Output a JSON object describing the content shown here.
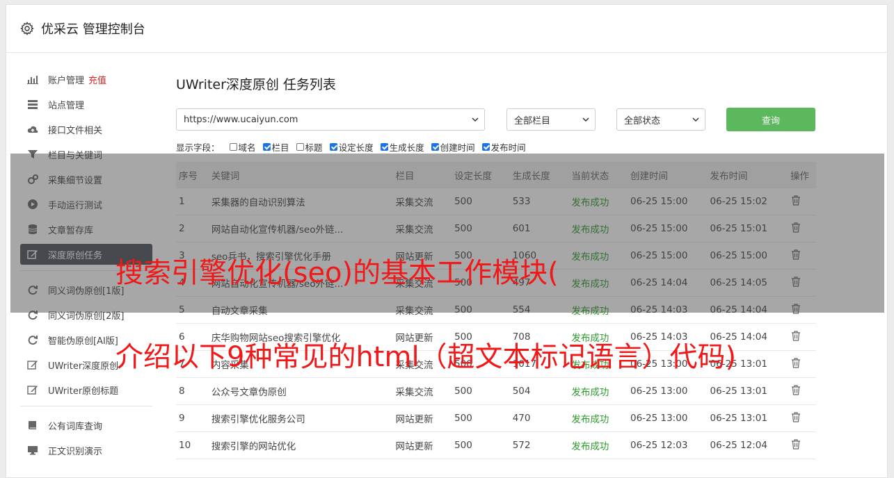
{
  "header": {
    "title": "优采云 管理控制台"
  },
  "sidebar": {
    "items": [
      {
        "label": "账户管理",
        "extra": "充值",
        "icon": "bar-chart-icon"
      },
      {
        "label": "站点管理",
        "icon": "server-icon"
      },
      {
        "label": "接口文件相关",
        "icon": "cloud-upload-icon"
      },
      {
        "label": "栏目与关键词",
        "icon": "filter-icon"
      },
      {
        "label": "采集细节设置",
        "icon": "gears-icon"
      },
      {
        "label": "手动运行测试",
        "icon": "play-circle-icon"
      },
      {
        "label": "文章暂存库",
        "icon": "database-icon"
      },
      {
        "label": "深度原创任务",
        "icon": "edit-icon",
        "active": true
      },
      {
        "label": "同义词伪原创[1版]",
        "icon": "refresh-icon"
      },
      {
        "label": "同义词伪原创[2版]",
        "icon": "refresh-icon"
      },
      {
        "label": "智能伪原创[AI版]",
        "icon": "refresh-icon"
      },
      {
        "label": "UWriter深度原创",
        "icon": "edit-icon"
      },
      {
        "label": "UWriter原创标题",
        "icon": "edit-icon"
      },
      {
        "label": "公有词库查询",
        "icon": "book-icon"
      },
      {
        "label": "正文识别演示",
        "icon": "monitor-icon"
      }
    ]
  },
  "main": {
    "title": "UWriter深度原创 任务列表",
    "site_select": "https://www.ucaiyun.com",
    "column_select": "全部栏目",
    "status_select": "全部状态",
    "query_button": "查询",
    "fields_label": "显示字段：",
    "fields": [
      {
        "label": "域名",
        "checked": false
      },
      {
        "label": "栏目",
        "checked": true
      },
      {
        "label": "标题",
        "checked": false
      },
      {
        "label": "设定长度",
        "checked": true
      },
      {
        "label": "生成长度",
        "checked": true
      },
      {
        "label": "创建时间",
        "checked": true
      },
      {
        "label": "发布时间",
        "checked": true
      }
    ],
    "table": {
      "headers": [
        "序号",
        "关键词",
        "栏目",
        "设定长度",
        "生成长度",
        "当前状态",
        "创建时间",
        "发布时间",
        "操作"
      ],
      "rows": [
        [
          "1",
          "采集器的自动识别算法",
          "采集交流",
          "500",
          "533",
          "发布成功",
          "06-25 15:00",
          "06-25 15:02"
        ],
        [
          "2",
          "网站自动化宣传机器/seo外链...",
          "采集交流",
          "500",
          "601",
          "发布成功",
          "06-25 15:00",
          "06-25 15:01"
        ],
        [
          "3",
          "seo兵书，搜索引擎优化手册",
          "网站更新",
          "500",
          "1060",
          "发布成功",
          "06-25 15:00",
          "06-25 15:00"
        ],
        [
          "4",
          "网站自动化宣传机器/seo外链...",
          "采集交流",
          "500",
          "497",
          "发布成功",
          "06-25 14:04",
          "06-25 14:05"
        ],
        [
          "5",
          "自动文章采集",
          "采集交流",
          "500",
          "554",
          "发布成功",
          "06-25 14:03",
          "06-25 14:04"
        ],
        [
          "6",
          "庆华购物网站seo搜索引擎优化",
          "网站更新",
          "500",
          "708",
          "发布成功",
          "06-25 14:03",
          "06-25 14:04"
        ],
        [
          "7",
          "内容采集",
          "采集交流",
          "500",
          "1017",
          "发布成功",
          "06-25 13:00",
          "06-25 13:01"
        ],
        [
          "8",
          "公众号文章伪原创",
          "采集交流",
          "500",
          "504",
          "发布成功",
          "06-25 13:00",
          "06-25 13:01"
        ],
        [
          "9",
          "搜索引擎优化服务公司",
          "网站更新",
          "500",
          "470",
          "发布成功",
          "06-25 13:00",
          "06-25 13:01"
        ],
        [
          "10",
          "搜索引擎的网站优化",
          "网站更新",
          "500",
          "572",
          "发布成功",
          "06-25 12:03",
          "06-25 12:04"
        ]
      ]
    }
  },
  "overlay": {
    "line1": "搜索引擎优化(seo)的基本工作模块(",
    "line2": "介绍以下9种常见的html（超文本标记语言）代码)"
  },
  "colors": {
    "accent_green": "#5cb85c",
    "status_ok": "#2e9a2e",
    "caption_red": "#f01818",
    "active_bg": "#4f5660"
  }
}
